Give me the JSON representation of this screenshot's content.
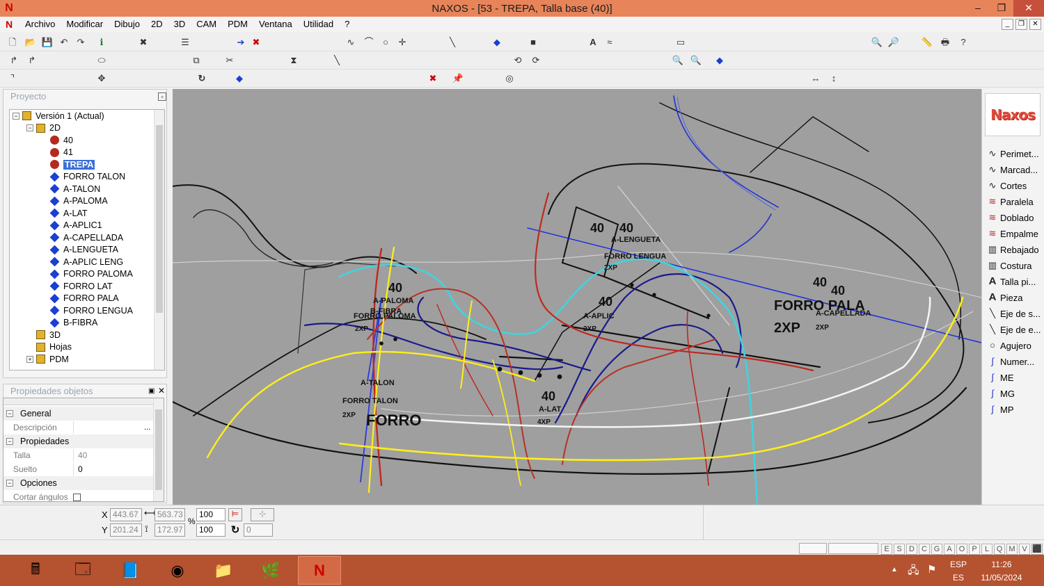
{
  "window": {
    "title": "NAXOS - [53 - TREPA, Talla base (40)]",
    "min": "‒",
    "restore": "❐",
    "close": "✕"
  },
  "menu": {
    "items": [
      "Archivo",
      "Modificar",
      "Dibujo",
      "2D",
      "3D",
      "CAM",
      "PDM",
      "Ventana",
      "Utilidad",
      "?"
    ]
  },
  "project_panel": {
    "title": "Proyecto",
    "tree": [
      {
        "label": "Versión 1 (Actual)",
        "icon": "version-icon",
        "level": 0,
        "expander": "−"
      },
      {
        "label": "2D",
        "icon": "2d-folder-icon",
        "level": 1,
        "expander": "−"
      },
      {
        "label": "40",
        "icon": "size-dot-icon",
        "level": 2
      },
      {
        "label": "41",
        "icon": "size-dot-icon",
        "level": 2
      },
      {
        "label": "TREPA",
        "icon": "size-dot-icon",
        "level": 2,
        "selected": true
      },
      {
        "label": "FORRO TALON",
        "icon": "piece-diamond-icon",
        "level": 2
      },
      {
        "label": "A-TALON",
        "icon": "piece-diamond-icon",
        "level": 2
      },
      {
        "label": "A-PALOMA",
        "icon": "piece-diamond-icon",
        "level": 2
      },
      {
        "label": "A-LAT",
        "icon": "piece-diamond-icon",
        "level": 2
      },
      {
        "label": "A-APLIC1",
        "icon": "piece-diamond-icon",
        "level": 2
      },
      {
        "label": "A-CAPELLADA",
        "icon": "piece-diamond-icon",
        "level": 2
      },
      {
        "label": "A-LENGUETA",
        "icon": "piece-diamond-icon",
        "level": 2
      },
      {
        "label": "A-APLIC LENG",
        "icon": "piece-diamond-icon",
        "level": 2
      },
      {
        "label": "FORRO PALOMA",
        "icon": "piece-diamond-icon",
        "level": 2
      },
      {
        "label": "FORRO LAT",
        "icon": "piece-diamond-icon",
        "level": 2
      },
      {
        "label": "FORRO PALA",
        "icon": "piece-diamond-icon",
        "level": 2
      },
      {
        "label": "FORRO LENGUA",
        "icon": "piece-diamond-icon",
        "level": 2
      },
      {
        "label": "B-FIBRA",
        "icon": "piece-diamond-icon",
        "level": 2
      },
      {
        "label": "3D",
        "icon": "3d-icon",
        "level": 1
      },
      {
        "label": "Hojas",
        "icon": "sheets-icon",
        "level": 1
      },
      {
        "label": "PDM",
        "icon": "pdm-folder-icon",
        "level": 1,
        "expander": "+"
      }
    ]
  },
  "properties_panel": {
    "title": "Propiedades objetos",
    "sections": [
      {
        "name": "General",
        "rows": [
          {
            "key": "Descripción",
            "value": ""
          }
        ]
      },
      {
        "name": "Propiedades",
        "rows": [
          {
            "key": "Talla",
            "value": "40"
          },
          {
            "key": "Suelto",
            "value": "0"
          }
        ]
      },
      {
        "name": "Opciones",
        "rows": [
          {
            "key": "Cortar ángulos vi",
            "value": ""
          }
        ]
      }
    ],
    "ellipsis": "..."
  },
  "right_tools": {
    "logo": "Naxos",
    "items": [
      {
        "label": "Perimet...",
        "icon": "perimeter-curve-icon"
      },
      {
        "label": "Marcad...",
        "icon": "marker-curve-icon"
      },
      {
        "label": "Cortes",
        "icon": "cut-curve-icon"
      },
      {
        "label": "Paralela",
        "icon": "parallel-icon"
      },
      {
        "label": "Doblado",
        "icon": "fold-icon"
      },
      {
        "label": "Empalme",
        "icon": "splice-icon"
      },
      {
        "label": "Rebajado",
        "icon": "skive-icon"
      },
      {
        "label": "Costura",
        "icon": "seam-icon"
      },
      {
        "label": "Talla pi...",
        "icon": "size-text-icon"
      },
      {
        "label": "Pieza",
        "icon": "piece-text-icon"
      },
      {
        "label": "Eje de s...",
        "icon": "axis-icon"
      },
      {
        "label": "Eje de e...",
        "icon": "axis2-icon"
      },
      {
        "label": "Agujero",
        "icon": "hole-icon"
      },
      {
        "label": "Numer...",
        "icon": "number-icon"
      },
      {
        "label": "ME",
        "icon": "me-icon"
      },
      {
        "label": "MG",
        "icon": "mg-icon"
      },
      {
        "label": "MP",
        "icon": "mp-icon"
      }
    ]
  },
  "canvas_labels": [
    "40",
    "40",
    "A-LENGUETA",
    "FORRO LENGUA",
    "2XP",
    "40",
    "A-PALOMA",
    "B-FIBRA",
    "FORRO PALOMA",
    "2XP",
    "40",
    "A-APLIC",
    "2XP",
    "40",
    "40",
    "FORRO PALA",
    "2XP",
    "A-CAPELLADA",
    "2XP",
    "A-TALON",
    "FORRO TALON",
    "2XP",
    "FORRO",
    "40",
    "A-LAT",
    "4XP"
  ],
  "coords": {
    "x_label": "X",
    "y_label": "Y",
    "x": "443.67",
    "y": "201.24",
    "w": "563.73",
    "h": "172.97",
    "scale_x": "100",
    "scale_y": "100",
    "pct": "%",
    "rot": "0"
  },
  "status_letters": [
    "E",
    "S",
    "D",
    "C",
    "G",
    "A",
    "O",
    "P",
    "L",
    "Q",
    "M",
    "V"
  ],
  "taskbar": {
    "lang_top": "ESP",
    "lang_bottom": "ES",
    "time": "11:26",
    "date": "11/05/2024"
  },
  "colors": {
    "titlebar": "#e8845a",
    "canvas": "#9f9f9f",
    "taskbar": "#b5522f",
    "accent_red": "#b5291f",
    "accent_blue": "#1b3fd1"
  }
}
